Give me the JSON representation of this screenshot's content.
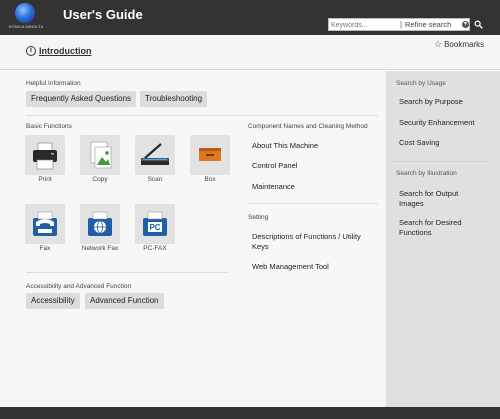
{
  "header": {
    "brand": "KONICA MINOLTA",
    "title": "User's Guide"
  },
  "subheader": {
    "intro_link": "Introduction",
    "bookmarks": "Bookmarks",
    "search_placeholder": "Keywords...",
    "refine_label": "Refine search"
  },
  "helpful": {
    "title": "Helpful Information",
    "items": [
      "Frequently Asked Questions",
      "Troubleshooting"
    ]
  },
  "basic": {
    "title": "Basic Functions",
    "tiles": [
      {
        "label": "Print",
        "icon": "printer-icon"
      },
      {
        "label": "Copy",
        "icon": "copy-icon"
      },
      {
        "label": "Scan",
        "icon": "scanner-icon"
      },
      {
        "label": "Box",
        "icon": "box-icon"
      },
      {
        "label": "Fax",
        "icon": "fax-icon"
      },
      {
        "label": "Network Fax",
        "icon": "network-fax-icon"
      },
      {
        "label": "PC-FAX",
        "icon": "pc-fax-icon"
      }
    ]
  },
  "components": {
    "title": "Component Names and Cleaning Method",
    "items": [
      "About This Machine",
      "Control Panel",
      "Maintenance"
    ]
  },
  "setting": {
    "title": "Setting",
    "items": [
      "Descriptions of Functions / Utility Keys",
      "Web Management Tool"
    ]
  },
  "accessibility": {
    "title": "Accessibility and Advanced Function",
    "items": [
      "Accessibility",
      "Advanced Function"
    ]
  },
  "right_panel": {
    "usage_title": "Search by Usage",
    "usage_items": [
      "Search by Purpose",
      "Security Enhancement",
      "Cost Saving"
    ],
    "illustration_title": "Search by Illustration",
    "illustration_items": [
      "Search for Output Images",
      "Search for Desired Functions"
    ]
  },
  "icon_glyphs": {
    "pc_fax_text": "PC"
  },
  "colors": {
    "header_bg": "#333333",
    "tile_bg": "#e2e2e2",
    "pill_bg": "#dcdcdc",
    "fax_blue": "#1f5fa8",
    "box_orange": "#e0761f",
    "copy_green": "#3f9a3f"
  }
}
